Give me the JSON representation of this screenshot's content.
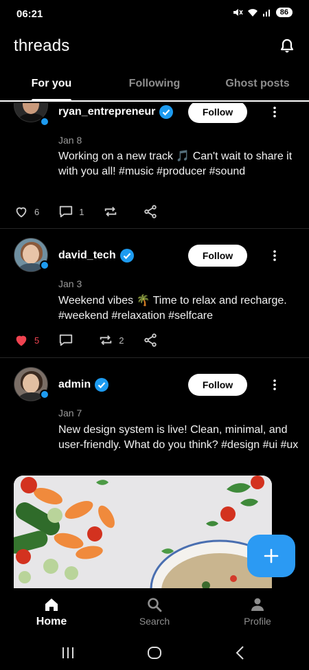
{
  "status": {
    "time": "06:21",
    "battery": "86"
  },
  "header": {
    "title": "threads"
  },
  "tabs": [
    {
      "label": "For you"
    },
    {
      "label": "Following"
    },
    {
      "label": "Ghost posts"
    }
  ],
  "follow_label": "Follow",
  "posts": [
    {
      "username": "ryan_entrepreneur",
      "date": "Jan 8",
      "text": "Working on a new track 🎵 Can't wait to share it with you all! #music #producer #sound",
      "likes": "6",
      "comments": "1",
      "reposts": "",
      "liked": false
    },
    {
      "username": "david_tech",
      "date": "Jan 3",
      "text": "Weekend vibes 🌴 Time to relax and recharge. #weekend #relaxation #selfcare",
      "likes": "5",
      "comments": "",
      "reposts": "2",
      "liked": true
    },
    {
      "username": "admin",
      "date": "Jan 7",
      "text": "New design system is live! Clean, minimal, and user-friendly. What do you think? #design #ui #ux",
      "likes": "",
      "comments": "",
      "reposts": "",
      "liked": false
    }
  ],
  "nav": [
    {
      "label": "Home",
      "icon": "home-icon"
    },
    {
      "label": "Search",
      "icon": "search-icon"
    },
    {
      "label": "Profile",
      "icon": "person-icon"
    }
  ],
  "colors": {
    "accent": "#2b9af3",
    "like": "#ef4350",
    "verified": "#1d9bf0"
  }
}
